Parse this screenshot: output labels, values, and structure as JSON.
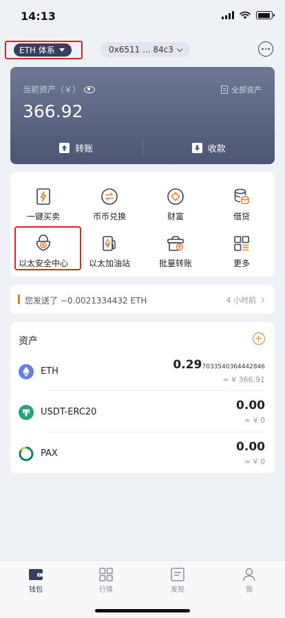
{
  "status_bar": {
    "time": "14:13"
  },
  "top_bar": {
    "network": "ETH 体系",
    "address": "0x6511 ... 84c3"
  },
  "asset_card": {
    "label": "当前资产（￥）",
    "all_assets": "全部资产",
    "total": "366.92",
    "transfer": "转账",
    "receive": "收款"
  },
  "features": [
    {
      "label": "一键买卖",
      "icon": "lightning-card-icon"
    },
    {
      "label": "币币兑换",
      "icon": "swap-icon"
    },
    {
      "label": "财富",
      "icon": "diamond-icon"
    },
    {
      "label": "借贷",
      "icon": "coins-stack-icon"
    },
    {
      "label": "以太安全中心",
      "icon": "shield-lock-icon"
    },
    {
      "label": "以太加油站",
      "icon": "gas-station-icon"
    },
    {
      "label": "批量转账",
      "icon": "batch-transfer-icon"
    },
    {
      "label": "更多",
      "icon": "more-grid-icon"
    }
  ],
  "transaction": {
    "text": "您发送了 −0.0021334432 ETH",
    "time": "4 小时前"
  },
  "assets": {
    "title": "资产",
    "tokens": [
      {
        "name": "ETH",
        "amount_main": "0.29",
        "amount_small": "7033540364442846",
        "fiat": "≈ ¥ 366.91",
        "color": "#627eea"
      },
      {
        "name": "USDT-ERC20",
        "amount_main": "0.00",
        "amount_small": "",
        "fiat": "≈ ¥ 0",
        "color": "#26a17b"
      },
      {
        "name": "PAX",
        "amount_main": "0.00",
        "amount_small": "",
        "fiat": "≈ ¥ 0",
        "color": "#00845d"
      }
    ]
  },
  "tabs": [
    {
      "label": "钱包",
      "icon": "wallet-icon",
      "active": true
    },
    {
      "label": "行情",
      "icon": "market-grid-icon",
      "active": false
    },
    {
      "label": "发现",
      "icon": "discover-icon",
      "active": false
    },
    {
      "label": "我",
      "icon": "profile-icon",
      "active": false
    }
  ],
  "colors": {
    "accent": "#e87b26",
    "highlight_red": "#e0211b",
    "primary_dark": "#37405a"
  }
}
